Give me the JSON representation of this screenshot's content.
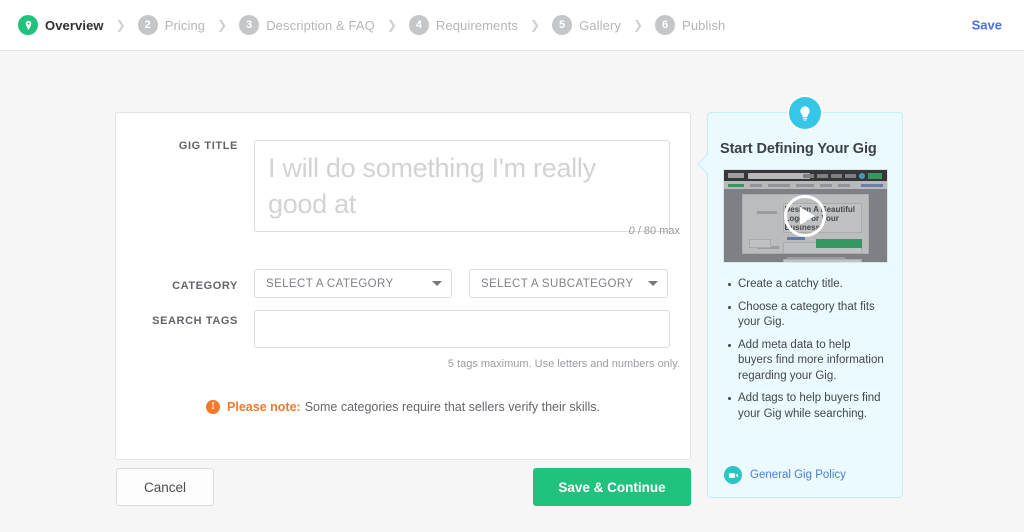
{
  "topbar": {
    "steps": [
      {
        "num": "1",
        "label": "Overview",
        "icon": "location-pin-icon",
        "active": true
      },
      {
        "num": "2",
        "label": "Pricing",
        "active": false
      },
      {
        "num": "3",
        "label": "Description & FAQ",
        "active": false
      },
      {
        "num": "4",
        "label": "Requirements",
        "active": false
      },
      {
        "num": "5",
        "label": "Gallery",
        "active": false
      },
      {
        "num": "6",
        "label": "Publish",
        "active": false
      }
    ],
    "separator": "❯",
    "save_label": "Save"
  },
  "form": {
    "gig_title": {
      "label": "GIG TITLE",
      "value": "",
      "placeholder": "I will do something I'm really good at",
      "count": "0",
      "count_suffix": "/ 80 max"
    },
    "category": {
      "label": "CATEGORY",
      "category_value": "SELECT A CATEGORY",
      "subcategory_value": "SELECT A SUBCATEGORY"
    },
    "search_tags": {
      "label": "SEARCH TAGS",
      "value": "",
      "hint": "5 tags maximum. Use letters and numbers only."
    },
    "note": {
      "icon": "info-exclamation-icon",
      "strong": "Please note:",
      "text": "Some categories require that sellers verify their skills."
    }
  },
  "tip_panel": {
    "badge_icon": "lightbulb-icon",
    "heading": "Start Defining Your Gig",
    "video": {
      "play_icon": "play-icon",
      "overlay_heading": "Design A Beautiful Logo For Your Business"
    },
    "bullets": [
      "Create a catchy title.",
      "Choose a category that fits your Gig.",
      "Add meta data to help buyers find more information regarding your Gig.",
      "Add tags to help buyers find your Gig while searching."
    ],
    "policy": {
      "icon": "video-camera-icon",
      "label": "General Gig Policy"
    }
  },
  "footer": {
    "cancel_label": "Cancel",
    "save_continue_label": "Save & Continue"
  },
  "colors": {
    "brand_green": "#21c17e",
    "link_blue": "#4a6ee0",
    "tip_cyan": "#35c6e8",
    "tip_bg": "#eafaff",
    "note_orange": "#f5792a",
    "policy_teal": "#2ec4c6"
  }
}
